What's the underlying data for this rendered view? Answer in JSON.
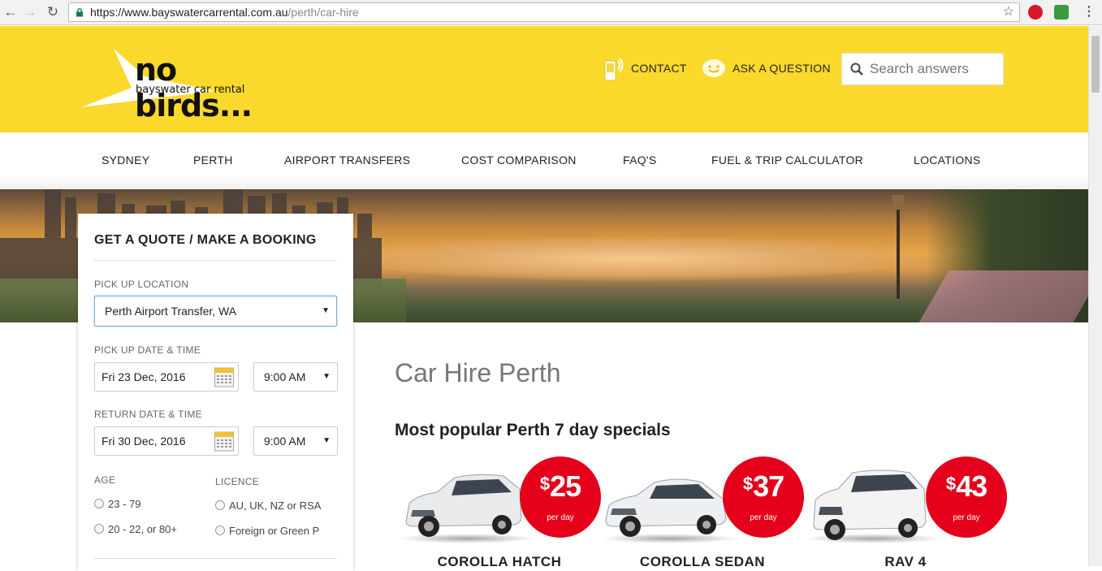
{
  "browser": {
    "url_host": "https://www.bayswatercarrental.com.au",
    "url_path": "/perth/car-hire"
  },
  "header": {
    "logo_main": "no birds...",
    "logo_sub": "bayswater car rental",
    "contact_label": "CONTACT",
    "ask_label": "ASK A QUESTION",
    "search_placeholder": "Search answers"
  },
  "nav": {
    "items": [
      "SYDNEY",
      "PERTH",
      "AIRPORT TRANSFERS",
      "COST COMPARISON",
      "FAQ'S",
      "FUEL & TRIP CALCULATOR",
      "LOCATIONS"
    ]
  },
  "booking": {
    "title": "GET A QUOTE / MAKE A BOOKING",
    "pickup_location_label": "PICK UP LOCATION",
    "pickup_location_value": "Perth Airport Transfer, WA",
    "pickup_datetime_label": "PICK UP DATE & TIME",
    "pickup_date": "Fri 23 Dec, 2016",
    "pickup_time": "9:00 AM",
    "return_datetime_label": "RETURN DATE & TIME",
    "return_date": "Fri 30 Dec, 2016",
    "return_time": "9:00 AM",
    "age_label": "AGE",
    "age_options": [
      "23 - 79",
      "20 - 22, or 80+"
    ],
    "licence_label": "LICENCE",
    "licence_options": [
      "AU, UK, NZ or RSA",
      "Foreign or Green P"
    ]
  },
  "content": {
    "page_title": "Car Hire Perth",
    "specials_title": "Most popular Perth 7 day specials",
    "cars": [
      {
        "name": "COROLLA HATCH",
        "currency": "$",
        "price": "25",
        "per": "per day"
      },
      {
        "name": "COROLLA SEDAN",
        "currency": "$",
        "price": "37",
        "per": "per day"
      },
      {
        "name": "RAV 4",
        "currency": "$",
        "price": "43",
        "per": "per day"
      }
    ]
  },
  "colors": {
    "header_yellow": "#fbd92c",
    "price_red": "#e4001b"
  }
}
